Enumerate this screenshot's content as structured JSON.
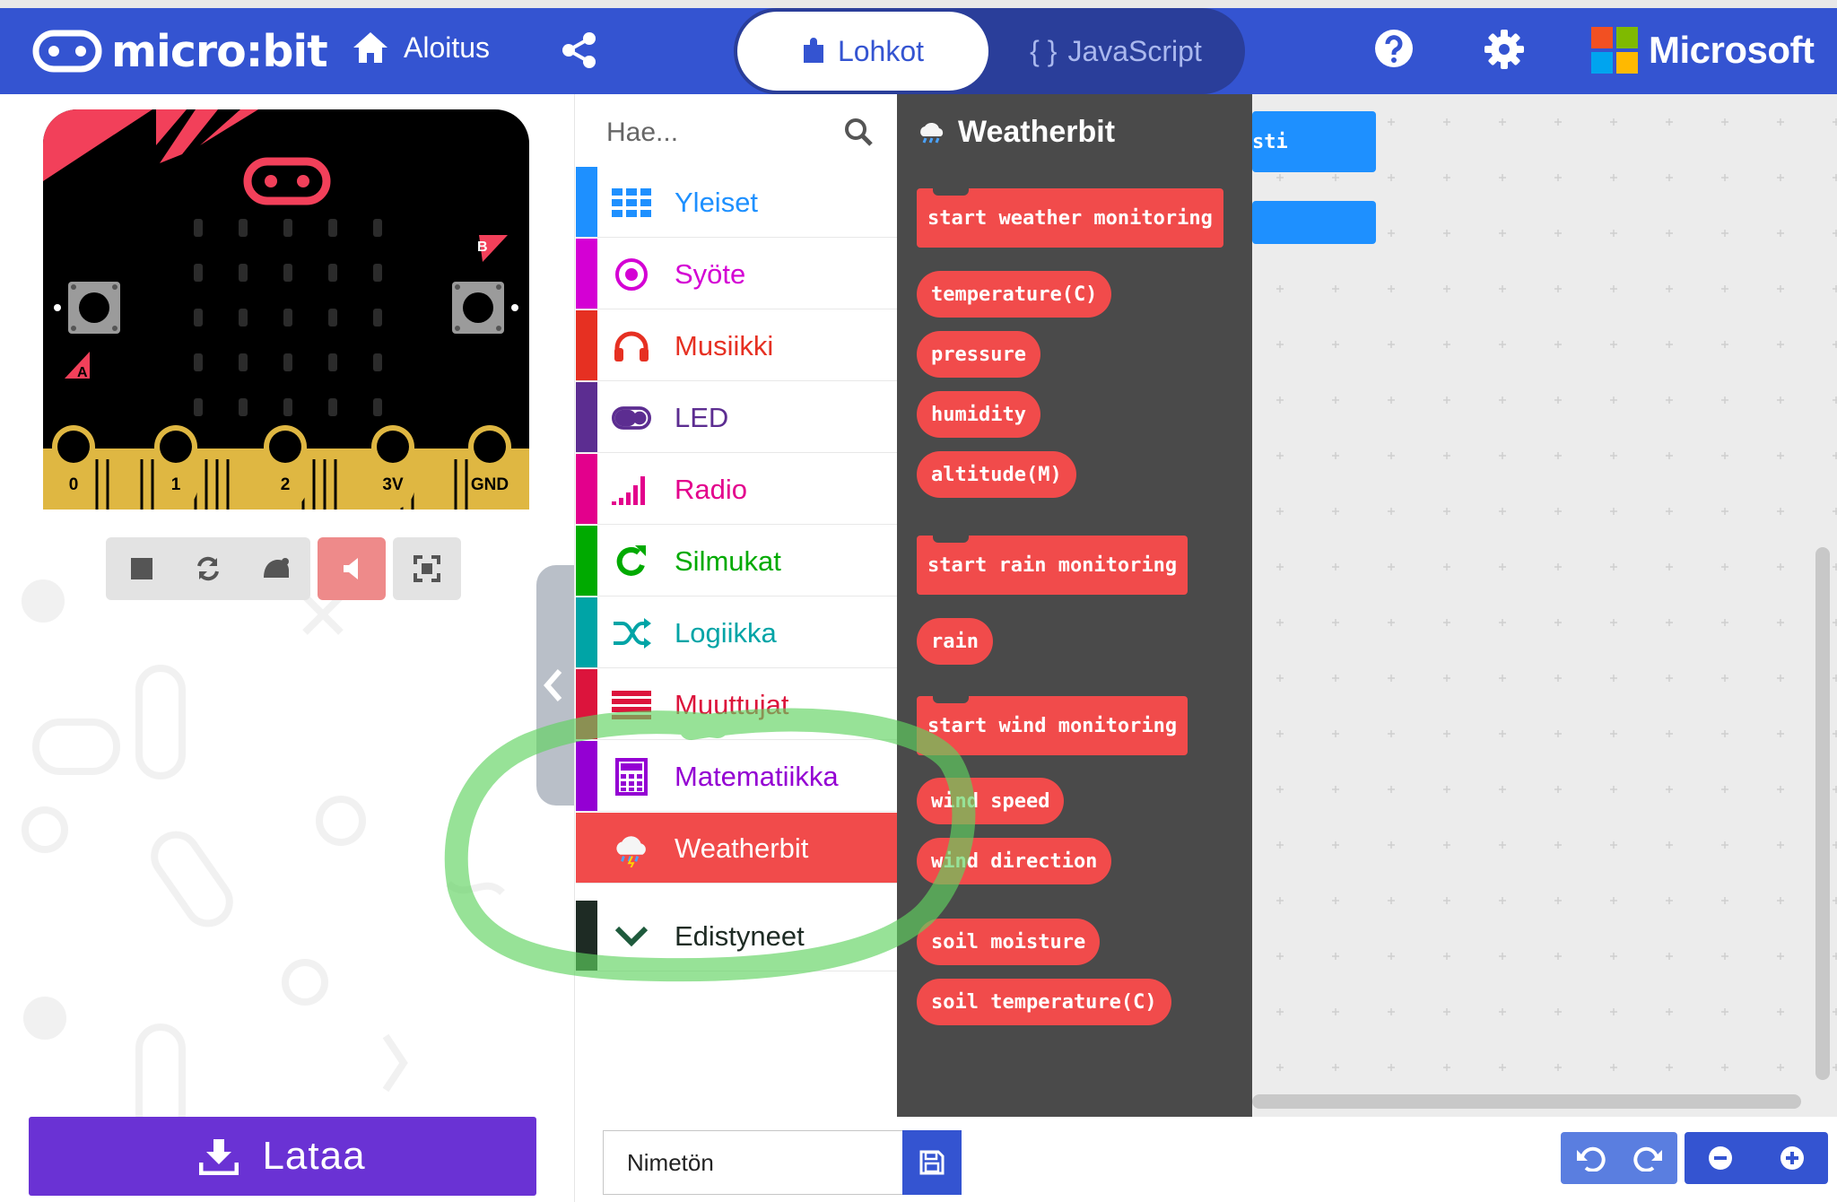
{
  "header": {
    "brand": "micro:bit",
    "home_label": "Aloitus",
    "tabs": [
      {
        "label": "Lohkot",
        "active": true
      },
      {
        "label": "JavaScript",
        "active": false
      }
    ],
    "ms_label": "Microsoft",
    "colors": {
      "bar": "#3454d1",
      "active_tab_text": "#3454d1"
    }
  },
  "simulator": {
    "pins": [
      "0",
      "1",
      "2",
      "3V",
      "GND"
    ],
    "buttons": [
      "A",
      "B"
    ],
    "toolbar_icons": [
      "stop-icon",
      "restart-icon",
      "slowmo-icon",
      "mute-icon",
      "fullscreen-icon"
    ]
  },
  "search": {
    "placeholder": "Hae..."
  },
  "categories": [
    {
      "label": "Yleiset",
      "color": "#1e90ff",
      "icon": "grid-icon"
    },
    {
      "label": "Syöte",
      "color": "#d400d4",
      "icon": "target-icon"
    },
    {
      "label": "Musiikki",
      "color": "#e63022",
      "icon": "headphones-icon"
    },
    {
      "label": "LED",
      "color": "#5c2d91",
      "icon": "toggle-icon"
    },
    {
      "label": "Radio",
      "color": "#e3008c",
      "icon": "signal-bars-icon"
    },
    {
      "label": "Silmukat",
      "color": "#00aa00",
      "icon": "loop-icon"
    },
    {
      "label": "Logiikka",
      "color": "#00a4a6",
      "icon": "shuffle-icon"
    },
    {
      "label": "Muuttujat",
      "color": "#dc143c",
      "icon": "lines-icon"
    },
    {
      "label": "Matematiikka",
      "color": "#9400d3",
      "icon": "calculator-icon"
    },
    {
      "label": "Weatherbit",
      "color": "#f14b4b",
      "icon": "weather-icon",
      "active": true
    },
    {
      "label": "Edistyneet",
      "color": "#1e2b24",
      "icon": "chevron-down-icon"
    }
  ],
  "flyout": {
    "title": "Weatherbit",
    "blocks": [
      {
        "label": "start weather monitoring",
        "kind": "statement"
      },
      {
        "label": "temperature(C)",
        "kind": "reporter"
      },
      {
        "label": "pressure",
        "kind": "reporter"
      },
      {
        "label": "humidity",
        "kind": "reporter"
      },
      {
        "label": "altitude(M)",
        "kind": "reporter"
      },
      {
        "label": "start rain monitoring",
        "kind": "statement"
      },
      {
        "label": "rain",
        "kind": "reporter"
      },
      {
        "label": "start wind monitoring",
        "kind": "statement"
      },
      {
        "label": "wind speed",
        "kind": "reporter"
      },
      {
        "label": "wind direction",
        "kind": "reporter"
      },
      {
        "label": "soil moisture",
        "kind": "reporter"
      },
      {
        "label": "soil temperature(C)",
        "kind": "reporter"
      }
    ]
  },
  "workspace": {
    "partial_block_text": "sti"
  },
  "bottom": {
    "download_label": "Lataa",
    "project_name": "Nimetön"
  }
}
